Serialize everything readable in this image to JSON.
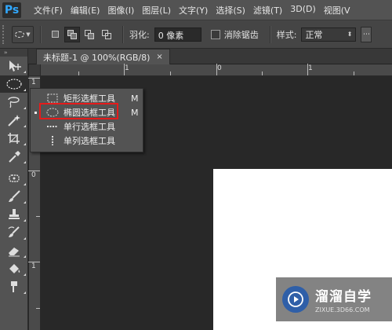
{
  "app": {
    "logo": "Ps"
  },
  "menu": {
    "items": [
      "文件(F)",
      "编辑(E)",
      "图像(I)",
      "图层(L)",
      "文字(Y)",
      "选择(S)",
      "滤镜(T)",
      "3D(D)",
      "视图(V"
    ]
  },
  "options": {
    "feather_label": "羽化:",
    "feather_value": "0 像素",
    "antialias_label": "消除锯齿",
    "style_label": "样式:",
    "style_value": "正常"
  },
  "toolbar": {
    "header": "››",
    "tools": [
      {
        "name": "move-tool",
        "icon": "move-icon"
      },
      {
        "name": "marquee-tool",
        "icon": "elliptical-marquee-icon",
        "active": true
      },
      {
        "name": "lasso-tool",
        "icon": "lasso-icon"
      },
      {
        "name": "magic-wand-tool",
        "icon": "magic-wand-icon"
      },
      {
        "name": "crop-tool",
        "icon": "crop-icon"
      },
      {
        "name": "eyedropper-tool",
        "icon": "eyedropper-icon"
      },
      {
        "name": "healing-brush-tool",
        "icon": "healing-brush-icon"
      },
      {
        "name": "brush-tool",
        "icon": "brush-icon"
      },
      {
        "name": "clone-stamp-tool",
        "icon": "stamp-icon"
      },
      {
        "name": "history-brush-tool",
        "icon": "history-brush-icon"
      },
      {
        "name": "eraser-tool",
        "icon": "eraser-icon"
      },
      {
        "name": "paint-bucket-tool",
        "icon": "paint-bucket-icon"
      },
      {
        "name": "smudge-tool",
        "icon": "smudge-icon"
      }
    ]
  },
  "document": {
    "tab_title": "未标题-1 @ 100%(RGB/8)",
    "close": "×"
  },
  "rulers": {
    "h_labels": [
      "1",
      "0",
      "1"
    ],
    "v_labels": [
      "1",
      "0",
      "1"
    ]
  },
  "flyout": {
    "items": [
      {
        "label": "矩形选框工具",
        "key": "M",
        "icon": "rectangular-marquee-icon"
      },
      {
        "label": "椭圆选框工具",
        "key": "M",
        "icon": "elliptical-marquee-icon",
        "selected": true
      },
      {
        "label": "单行选框工具",
        "key": "",
        "icon": "single-row-marquee-icon"
      },
      {
        "label": "单列选框工具",
        "key": "",
        "icon": "single-column-marquee-icon"
      }
    ]
  },
  "watermark": {
    "title": "溜溜自学",
    "url": "ZIXUE.3D66.COM"
  },
  "colors": {
    "highlight": "#e51b1b",
    "ps_blue": "#31a8ff",
    "canvas": "#ffffff"
  }
}
